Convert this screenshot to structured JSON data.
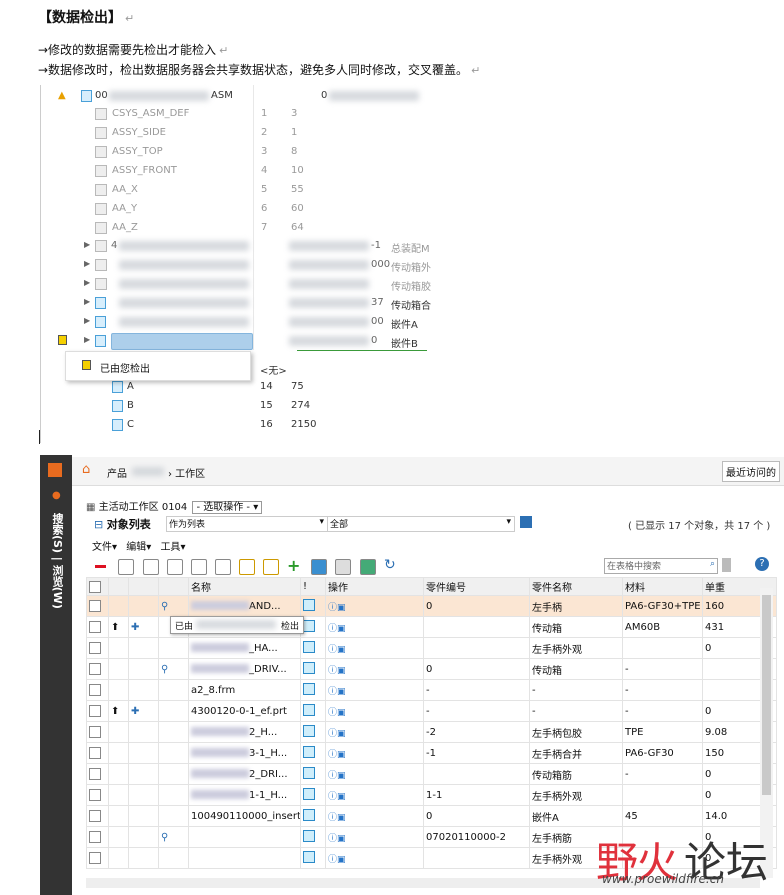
{
  "doc": {
    "title": "【数据检出】",
    "return_mark": "↵",
    "bullet1": "→修改的数据需要先检出才能检入",
    "bullet2": "→数据修改时，检出数据服务器会共享数据状态，避免多人同时修改，交叉覆盖。"
  },
  "tree": {
    "root_label_start": "00",
    "root_label_end": "ASM",
    "root_right": "0",
    "rows": [
      {
        "label": "CSYS_ASM_DEF",
        "c1": "1",
        "c2": "3"
      },
      {
        "label": "ASSY_SIDE",
        "c1": "2",
        "c2": "1"
      },
      {
        "label": "ASSY_TOP",
        "c1": "3",
        "c2": "8"
      },
      {
        "label": "ASSY_FRONT",
        "c1": "4",
        "c2": "10"
      },
      {
        "label": "AA_X",
        "c1": "5",
        "c2": "55"
      },
      {
        "label": "AA_Y",
        "c1": "6",
        "c2": "60"
      },
      {
        "label": "AA_Z",
        "c1": "7",
        "c2": "64"
      }
    ],
    "sub_rows": [
      {
        "prefix": "4",
        "mid": "-1",
        "right": "总装配M"
      },
      {
        "prefix": "",
        "mid": "000",
        "right": "传动箱外"
      },
      {
        "prefix": "",
        "mid": "",
        "right": "传动箱胶"
      },
      {
        "prefix": "",
        "mid": "37",
        "right": "传动箱合"
      },
      {
        "prefix": "",
        "mid": "00",
        "right": "嵌件A"
      },
      {
        "prefix": "",
        "mid": "0",
        "right": "嵌件B"
      }
    ],
    "context_item": "已由您检出",
    "none_label": "<无>",
    "feature_rows": [
      {
        "label": "A",
        "c1": "14",
        "c2": "75"
      },
      {
        "label": "B",
        "c1": "15",
        "c2": "274"
      },
      {
        "label": "C",
        "c1": "16",
        "c2": "2150"
      }
    ]
  },
  "window": {
    "sidebar_label": "搜索(S) | 浏览(W)",
    "breadcrumb": "产品",
    "breadcrumb_tail": "› 工作区",
    "recent": "最近访问的",
    "workspace_label": "主活动工作区",
    "workspace_id": "0104",
    "select_action": "- 选取操作 -",
    "object_list": "对象列表",
    "view_as": "作为列表",
    "filter": "全部",
    "shown_count": "( 已显示 17 个对象，共 17 个 )",
    "menus": [
      "文件",
      "编辑",
      "工具"
    ],
    "search_placeholder": "在表格中搜索",
    "columns": [
      "名称",
      "!",
      "操作",
      "零件编号",
      "零件名称",
      "材料",
      "单重"
    ],
    "tooltip_left": "已由",
    "tooltip_right": "检出",
    "rows": [
      {
        "name_end": "AND...",
        "num": "0",
        "pname": "左手柄",
        "mat": "PA6-GF30+TPE",
        "wt": "160"
      },
      {
        "name_end": "DRIV...",
        "num": "",
        "pname": "传动箱",
        "mat": "AM60B",
        "wt": "431"
      },
      {
        "name_end": "_HA...",
        "num": "",
        "pname": "左手柄外观",
        "mat": "",
        "wt": "0"
      },
      {
        "name_end": "_DRIV...",
        "num": "0",
        "pname": "传动箱",
        "mat": "-",
        "wt": ""
      },
      {
        "name_end": "a2_8.frm",
        "num": "-",
        "pname": "-",
        "mat": "-",
        "wt": ""
      },
      {
        "name_end": "4300120-0-1_ef.prt",
        "num": "-",
        "pname": "-",
        "mat": "-",
        "wt": "0"
      },
      {
        "name_end": "2_H...",
        "num": "-2",
        "pname": "左手柄包胶",
        "mat": "TPE",
        "wt": "9.08"
      },
      {
        "name_end": "3-1_H...",
        "num": "-1",
        "pname": "左手柄合并",
        "mat": "PA6-GF30",
        "wt": "150"
      },
      {
        "name_end": "2_DRI...",
        "num": "",
        "pname": "传动箱筋",
        "mat": "-",
        "wt": "0"
      },
      {
        "name_end": "1-1_H...",
        "num": "1-1",
        "pname": "左手柄外观",
        "mat": "",
        "wt": "0"
      },
      {
        "name_end": "100490110000_insert...",
        "num": "0",
        "pname": "嵌件A",
        "mat": "45",
        "wt": "14.0"
      },
      {
        "name_end": "",
        "num": "07020110000-2",
        "pname": "左手柄筋",
        "mat": "",
        "wt": "0"
      },
      {
        "name_end": "",
        "num": "",
        "pname": "左手柄外观",
        "mat": "",
        "wt": "0"
      }
    ]
  },
  "watermark": {
    "part1": "野火",
    "part2": "论坛",
    "url": "www.proewildfire.cn"
  }
}
